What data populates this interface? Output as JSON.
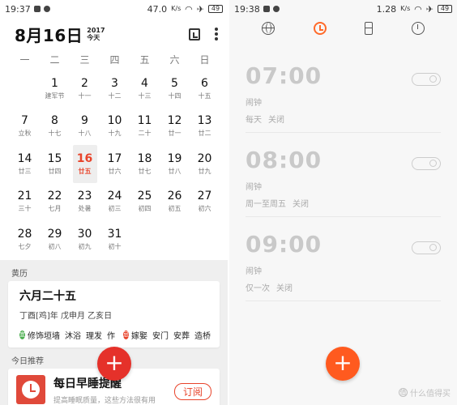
{
  "left": {
    "statusbar": {
      "time": "19:37",
      "speed": "47.0",
      "speed_unit": "K/s",
      "battery": "49"
    },
    "header": {
      "title": "8月16日",
      "year": "2017",
      "today_label": "今天",
      "today_icon": "today-calendar-icon",
      "more_icon": "more-vert-icon"
    },
    "weekdays": [
      "一",
      "二",
      "三",
      "四",
      "五",
      "六",
      "日"
    ],
    "first_weekday_offset": 1,
    "days": [
      {
        "num": "1",
        "lunar": "建军节"
      },
      {
        "num": "2",
        "lunar": "十一"
      },
      {
        "num": "3",
        "lunar": "十二"
      },
      {
        "num": "4",
        "lunar": "十三"
      },
      {
        "num": "5",
        "lunar": "十四"
      },
      {
        "num": "6",
        "lunar": "十五"
      },
      {
        "num": "7",
        "lunar": "立秋"
      },
      {
        "num": "8",
        "lunar": "十七"
      },
      {
        "num": "9",
        "lunar": "十八"
      },
      {
        "num": "10",
        "lunar": "十九"
      },
      {
        "num": "11",
        "lunar": "二十"
      },
      {
        "num": "12",
        "lunar": "廿一"
      },
      {
        "num": "13",
        "lunar": "廿二"
      },
      {
        "num": "14",
        "lunar": "廿三"
      },
      {
        "num": "15",
        "lunar": "廿四"
      },
      {
        "num": "16",
        "lunar": "廿五",
        "today": true
      },
      {
        "num": "17",
        "lunar": "廿六"
      },
      {
        "num": "18",
        "lunar": "廿七"
      },
      {
        "num": "19",
        "lunar": "廿八"
      },
      {
        "num": "20",
        "lunar": "廿九"
      },
      {
        "num": "21",
        "lunar": "三十"
      },
      {
        "num": "22",
        "lunar": "七月"
      },
      {
        "num": "23",
        "lunar": "处暑"
      },
      {
        "num": "24",
        "lunar": "初三"
      },
      {
        "num": "25",
        "lunar": "初四"
      },
      {
        "num": "26",
        "lunar": "初五"
      },
      {
        "num": "27",
        "lunar": "初六"
      },
      {
        "num": "28",
        "lunar": "七夕"
      },
      {
        "num": "29",
        "lunar": "初八"
      },
      {
        "num": "30",
        "lunar": "初九"
      },
      {
        "num": "31",
        "lunar": "初十"
      }
    ],
    "almanac": {
      "section": "黄历",
      "lunar_date": "六月二十五",
      "ganzhi": "丁酉[鸡]年 戊申月 乙亥日",
      "yi_label": "宜",
      "yi": [
        "修饰垣墙",
        "沐浴",
        "理发",
        "作"
      ],
      "ji_label": "忌",
      "ji": [
        "嫁娶",
        "安门",
        "安葬",
        "造桥"
      ]
    },
    "recommend": {
      "section": "今日推荐",
      "title": "每日早睡提醒",
      "subtitle": "提高睡眠质量，这些方法很有用",
      "button": "订阅",
      "icon": "clock-icon"
    },
    "fab": "+"
  },
  "right": {
    "statusbar": {
      "time": "19:38",
      "speed": "1.28",
      "speed_unit": "K/s",
      "battery": "49"
    },
    "tabs": [
      "world-clock-icon",
      "alarm-icon",
      "timer-icon",
      "stopwatch-icon"
    ],
    "alarms": [
      {
        "time": "07:00",
        "name": "闹钟",
        "repeat": "每天",
        "state": "关闭"
      },
      {
        "time": "08:00",
        "name": "闹钟",
        "repeat": "周一至周五",
        "state": "关闭"
      },
      {
        "time": "09:00",
        "name": "闹钟",
        "repeat": "仅一次",
        "state": "关闭"
      }
    ],
    "fab": "+",
    "watermark": "什么值得买",
    "watermark_logo": "值"
  },
  "colors": {
    "accent_red": "#e5312a",
    "accent_orange": "#ff5a1f",
    "today": "#e8432a"
  }
}
